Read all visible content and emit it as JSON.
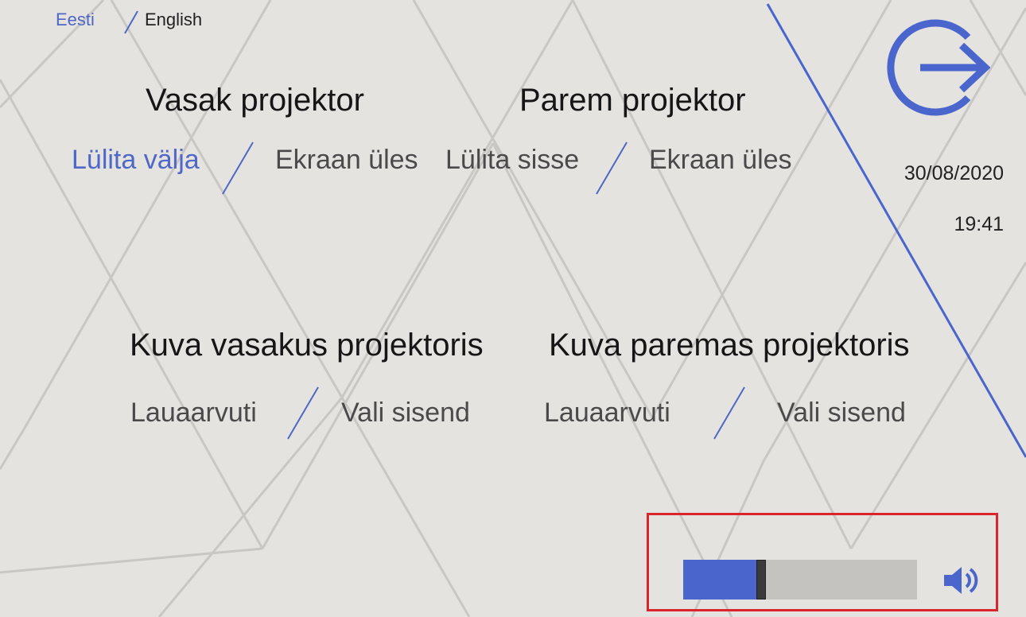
{
  "language": {
    "estonian": "Eesti",
    "english": "English"
  },
  "left_projector": {
    "title": "Vasak projektor",
    "power": "Lülita välja",
    "screen": "Ekraan üles"
  },
  "right_projector": {
    "title": "Parem projektor",
    "power": "Lülita sisse",
    "screen": "Ekraan üles"
  },
  "left_display": {
    "title": "Kuva vasakus projektoris",
    "source_desktop": "Lauaarvuti",
    "source_select": "Vali sisend"
  },
  "right_display": {
    "title": "Kuva paremas projektoris",
    "source_desktop": "Lauaarvuti",
    "source_select": "Vali sisend"
  },
  "status": {
    "date": "30/08/2020",
    "time": "19:41"
  },
  "volume": {
    "level": 0.32
  },
  "icons": {
    "exit": "exit-icon",
    "speaker": "speaker-icon"
  },
  "colors": {
    "accent": "#4a66cc",
    "highlight_border": "#d9252b",
    "background": "#e5e3e0"
  }
}
